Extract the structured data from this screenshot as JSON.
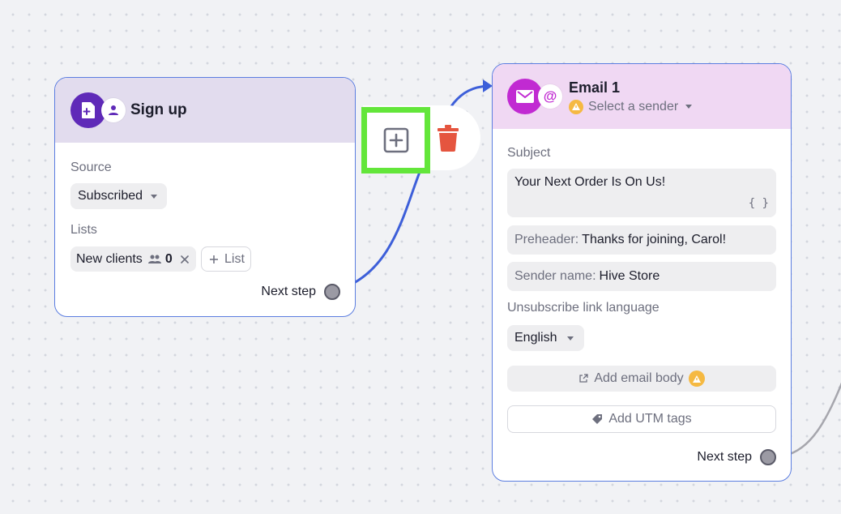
{
  "signup_node": {
    "title": "Sign up",
    "source_label": "Source",
    "source_value": "Subscribed",
    "lists_label": "Lists",
    "list_chip": {
      "name": "New clients",
      "count": "0"
    },
    "add_list_label": "List",
    "next_step_label": "Next step"
  },
  "toolbar": {
    "add_icon": "plus-square-icon",
    "delete_icon": "trash-icon"
  },
  "email_node": {
    "title": "Email 1",
    "sender_placeholder": "Select a sender",
    "subject_label": "Subject",
    "subject_value": "Your Next Order Is On Us!",
    "variables_glyph": "{ }",
    "preheader_label": "Preheader:",
    "preheader_value": "Thanks for joining, Carol!",
    "sender_name_label": "Sender name:",
    "sender_name_value": "Hive Store",
    "unsubscribe_label": "Unsubscribe link language",
    "language_value": "English",
    "add_body_label": "Add email body",
    "add_utm_label": "Add UTM tags",
    "next_step_label": "Next step"
  },
  "colors": {
    "node_border": "#5b7de0",
    "connector": "#3d5fd9",
    "signup_header": "#e2dcee",
    "email_header": "#f0d8f3",
    "signup_icon": "#5f2ab8",
    "email_icon": "#c12ad2",
    "highlight": "#63e63a",
    "trash": "#e5553f",
    "warning": "#f5b942"
  }
}
